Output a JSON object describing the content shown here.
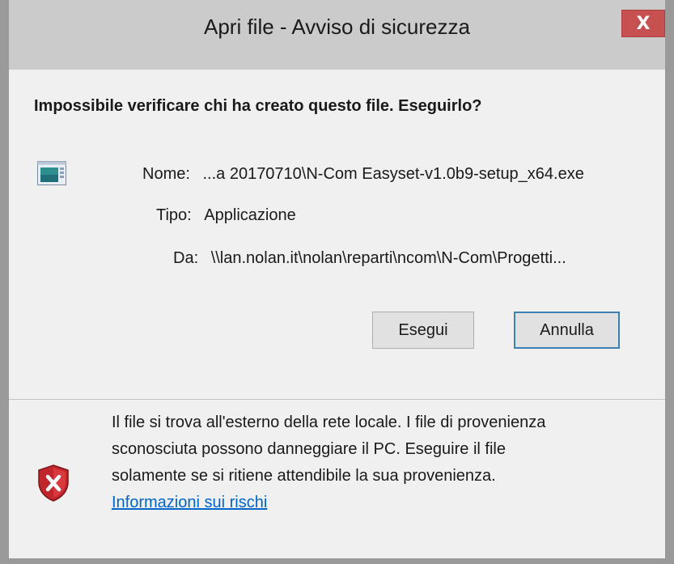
{
  "dialog": {
    "title": "Apri file - Avviso di sicurezza",
    "close_label": "X"
  },
  "main": {
    "heading": "Impossibile verificare chi ha creato questo file. Eseguirlo?",
    "file_icon": "application-window-icon",
    "fields": {
      "name_label": "Nome:",
      "name_value": "...a 20170710\\N-Com Easyset-v1.0b9-setup_x64.exe",
      "type_label": "Tipo:",
      "type_value": "Applicazione",
      "from_label": "Da:",
      "from_value": "\\\\lan.nolan.it\\nolan\\reparti\\ncom\\N-Com\\Progetti..."
    },
    "buttons": {
      "run": "Esegui",
      "cancel": "Annulla"
    }
  },
  "footer": {
    "shield_icon": "security-shield-error-icon",
    "warning_lines": [
      "Il file si trova all'esterno della rete locale. I file di provenienza",
      "sconosciuta possono danneggiare il PC. Eseguire il file",
      "solamente se si ritiene attendibile la sua provenienza."
    ],
    "link": "Informazioni sui rischi"
  },
  "colors": {
    "close_button": "#c75050",
    "link": "#0066cc",
    "shield_red": "#c0262b",
    "focus_border": "#3c7fb1"
  }
}
